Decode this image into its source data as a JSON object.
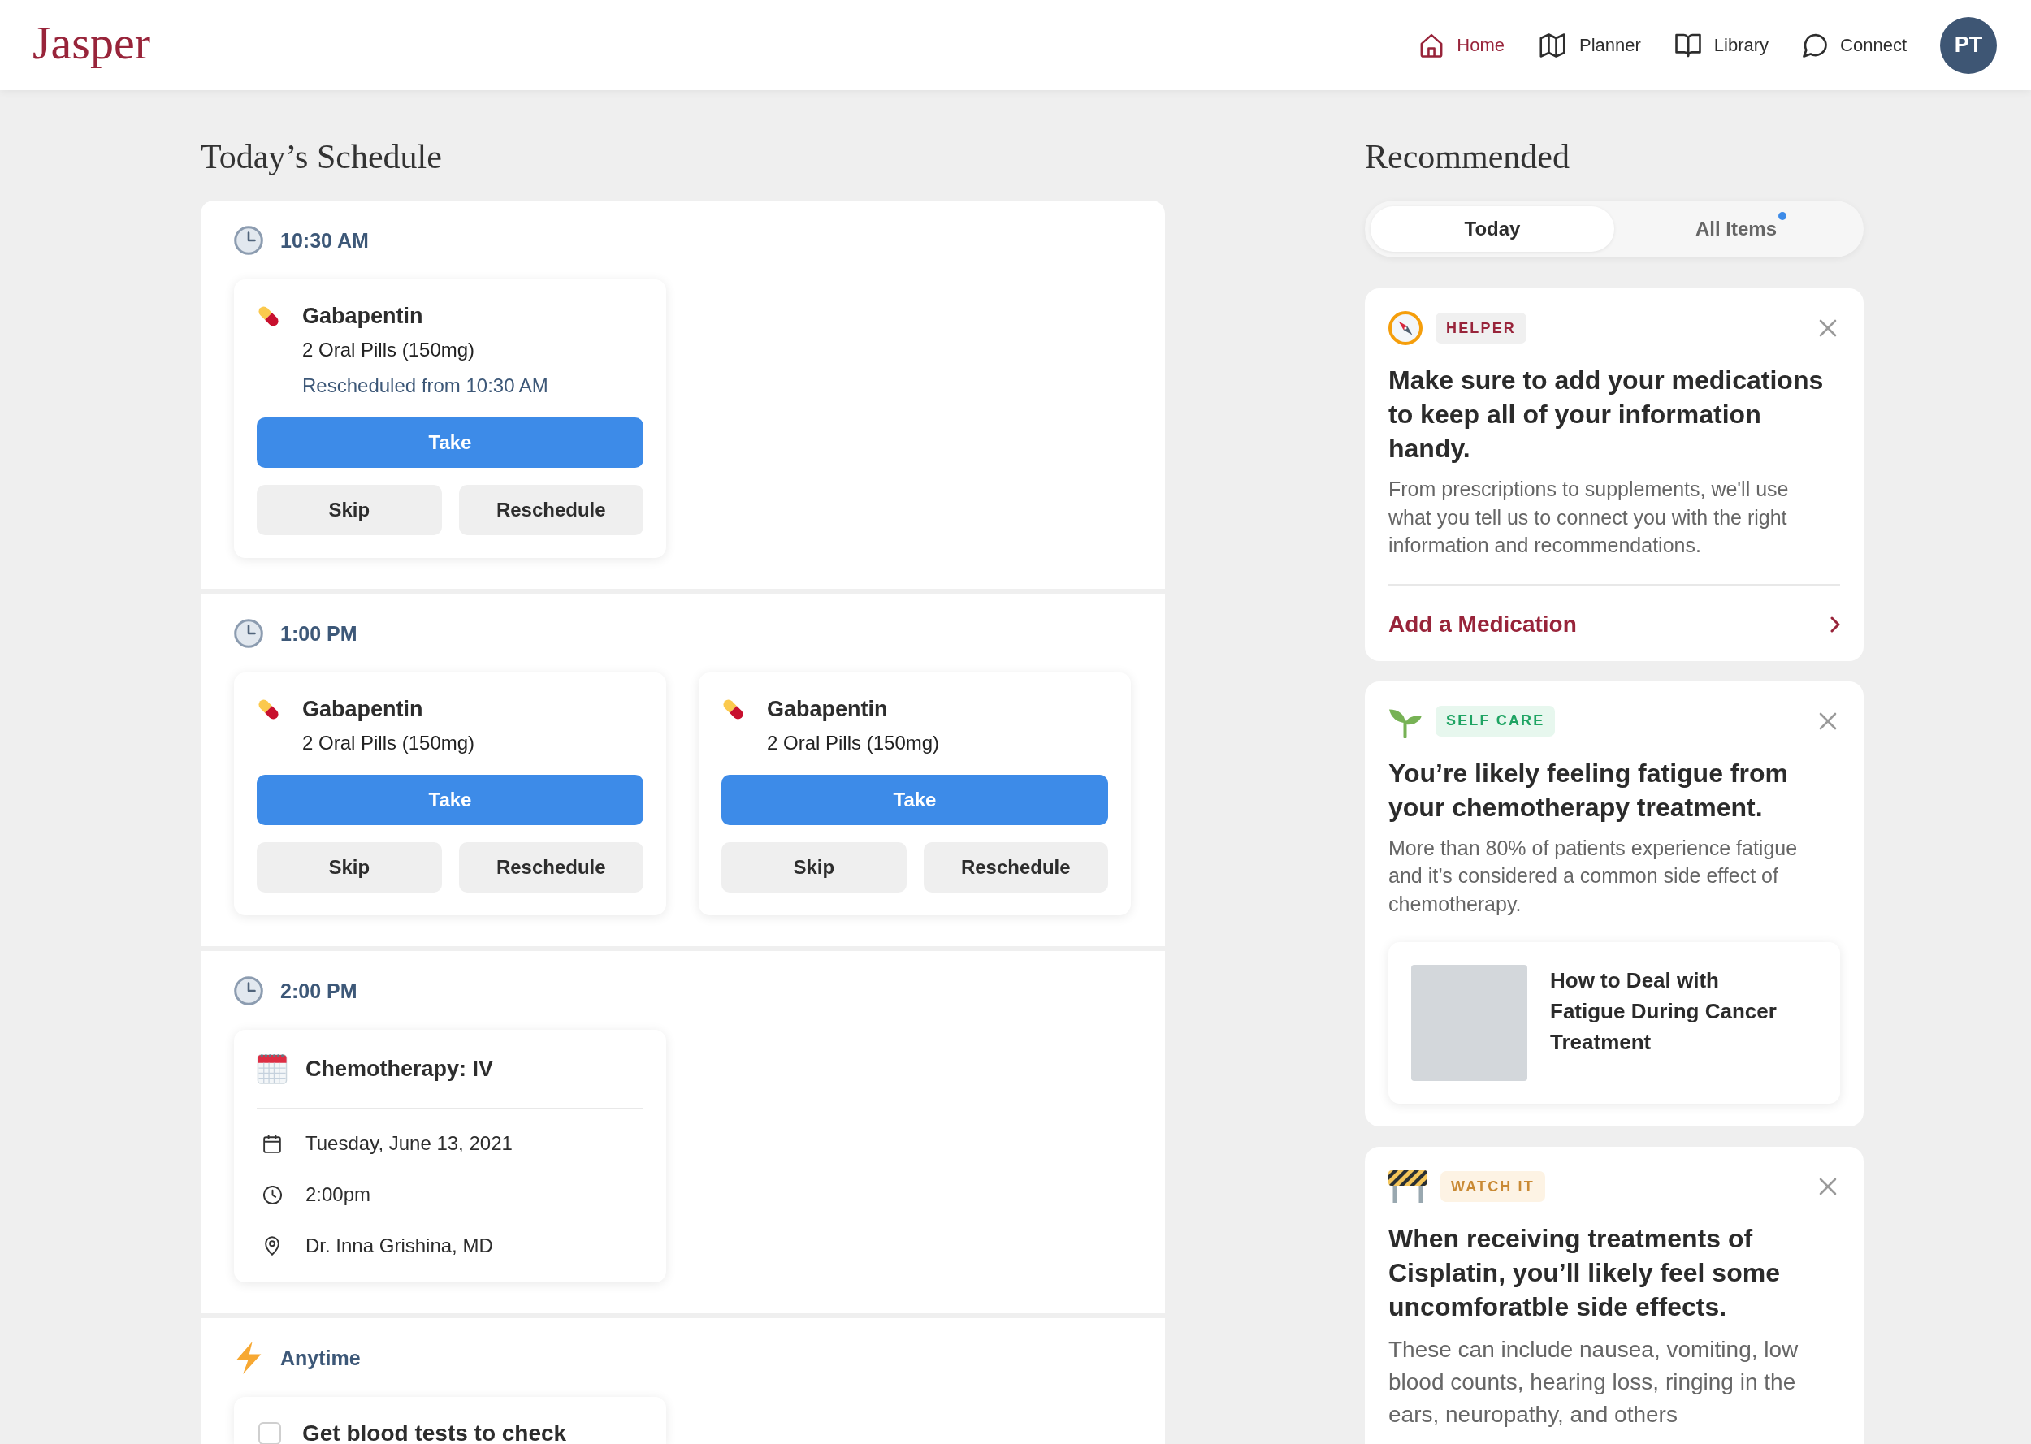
{
  "header": {
    "logo": "Jasper",
    "nav": [
      {
        "label": "Home",
        "selected": true
      },
      {
        "label": "Planner",
        "selected": false
      },
      {
        "label": "Library",
        "selected": false
      },
      {
        "label": "Connect",
        "selected": false
      }
    ],
    "avatar": "PT"
  },
  "schedule": {
    "title": "Today’s Schedule",
    "sections": [
      {
        "kind": "timed",
        "label": "10:30 AM",
        "items": [
          {
            "kind": "medication",
            "name": "Gabapentin",
            "dose": "2 Oral Pills (150mg)",
            "note": "Rescheduled from 10:30 AM",
            "take": "Take",
            "skip": "Skip",
            "reschedule": "Reschedule"
          }
        ]
      },
      {
        "kind": "timed",
        "label": "1:00 PM",
        "items": [
          {
            "kind": "medication",
            "name": "Gabapentin",
            "dose": "2 Oral Pills (150mg)",
            "take": "Take",
            "skip": "Skip",
            "reschedule": "Reschedule"
          },
          {
            "kind": "medication",
            "name": "Gabapentin",
            "dose": "2 Oral Pills (150mg)",
            "take": "Take",
            "skip": "Skip",
            "reschedule": "Reschedule"
          }
        ]
      },
      {
        "kind": "timed",
        "label": "2:00 PM",
        "items": [
          {
            "kind": "appointment",
            "title": "Chemotherapy: IV",
            "date": "Tuesday, June 13, 2021",
            "time": "2:00pm",
            "location": "Dr. Inna Grishina, MD"
          }
        ]
      },
      {
        "kind": "anytime",
        "label": "Anytime",
        "items": [
          {
            "kind": "task",
            "title": "Get blood tests to check",
            "checked": false
          }
        ]
      }
    ]
  },
  "recommended": {
    "title": "Recommended",
    "tabs": [
      {
        "label": "Today",
        "selected": true,
        "new": false
      },
      {
        "label": "All Items",
        "selected": false,
        "new": true
      }
    ],
    "cards": [
      {
        "kind": "helper",
        "tag": "HELPER",
        "title": "Make sure to add your medications to keep all of your information handy.",
        "body": "From prescriptions to supplements, we'll use what you tell us to connect you with the right information and recommendations.",
        "link": "Add a Medication"
      },
      {
        "kind": "self_care",
        "tag": "SELF CARE",
        "title": "You’re likely feeling fatigue from your chemotherapy treatment.",
        "body": "More than 80% of patients experience fatigue and it’s considered a common side effect of chemotherapy.",
        "article": {
          "title": "How to Deal with Fatigue During Cancer Treatment"
        }
      },
      {
        "kind": "watch_it",
        "tag": "WATCH IT",
        "title": "When receiving treatments of Cisplatin, you’ll likely feel some uncomforatble side effects.",
        "body": "These can include nausea, vomiting, low blood counts, hearing loss, ringing in the ears, neuropathy, and others"
      }
    ]
  }
}
